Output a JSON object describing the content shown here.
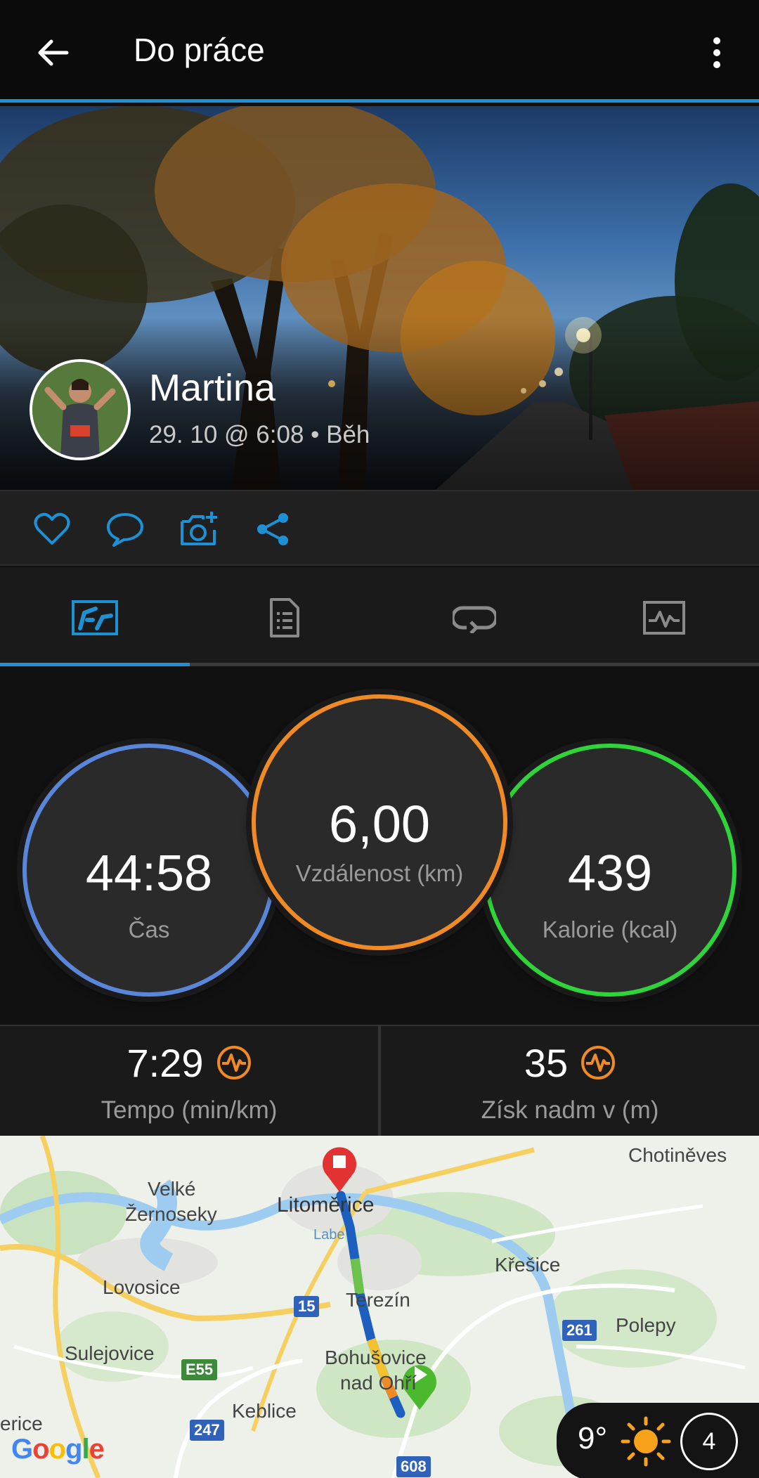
{
  "appbar": {
    "title": "Do práce"
  },
  "activity": {
    "user_name": "Martina",
    "meta": "29. 10 @ 6:08 • Běh"
  },
  "actions": [
    "like",
    "comment",
    "add-photo",
    "share"
  ],
  "tabs": [
    "overview",
    "details",
    "laps",
    "charts"
  ],
  "stats": {
    "time": {
      "value": "44:58",
      "label": "Čas"
    },
    "distance": {
      "value": "6,00",
      "label": "Vzdálenost (km)"
    },
    "calories": {
      "value": "439",
      "label": "Kalorie (kcal)"
    }
  },
  "metrics": {
    "tempo": {
      "value": "7:29",
      "label": "Tempo (min/km)"
    },
    "elevation": {
      "value": "35",
      "label": "Získ nadm v (m)"
    }
  },
  "map": {
    "places": {
      "velke": "Velké",
      "zernoseky": "Žernoseky",
      "litomerice": "Litoměrice",
      "chotineves": "Chotiněves",
      "labe": "Labe",
      "kresice": "Křešice",
      "lovosice": "Lovosice",
      "terezin": "Terezín",
      "polepy": "Polepy",
      "sulejovice": "Sulejovice",
      "bohusovice": "Bohušovice",
      "nad_ohri": "nad Ohří",
      "keblice": "Keblice",
      "erice": "erice"
    },
    "roads": {
      "r15": "15",
      "r261": "261",
      "e55": "E55",
      "r247": "247",
      "r608": "608"
    },
    "logo": "Google"
  },
  "weather": {
    "temp": "9°",
    "wind": "4"
  },
  "colors": {
    "accent": "#1e90d4",
    "time": "#5a86d9",
    "distance": "#f08a24",
    "calories": "#2ed43a"
  }
}
